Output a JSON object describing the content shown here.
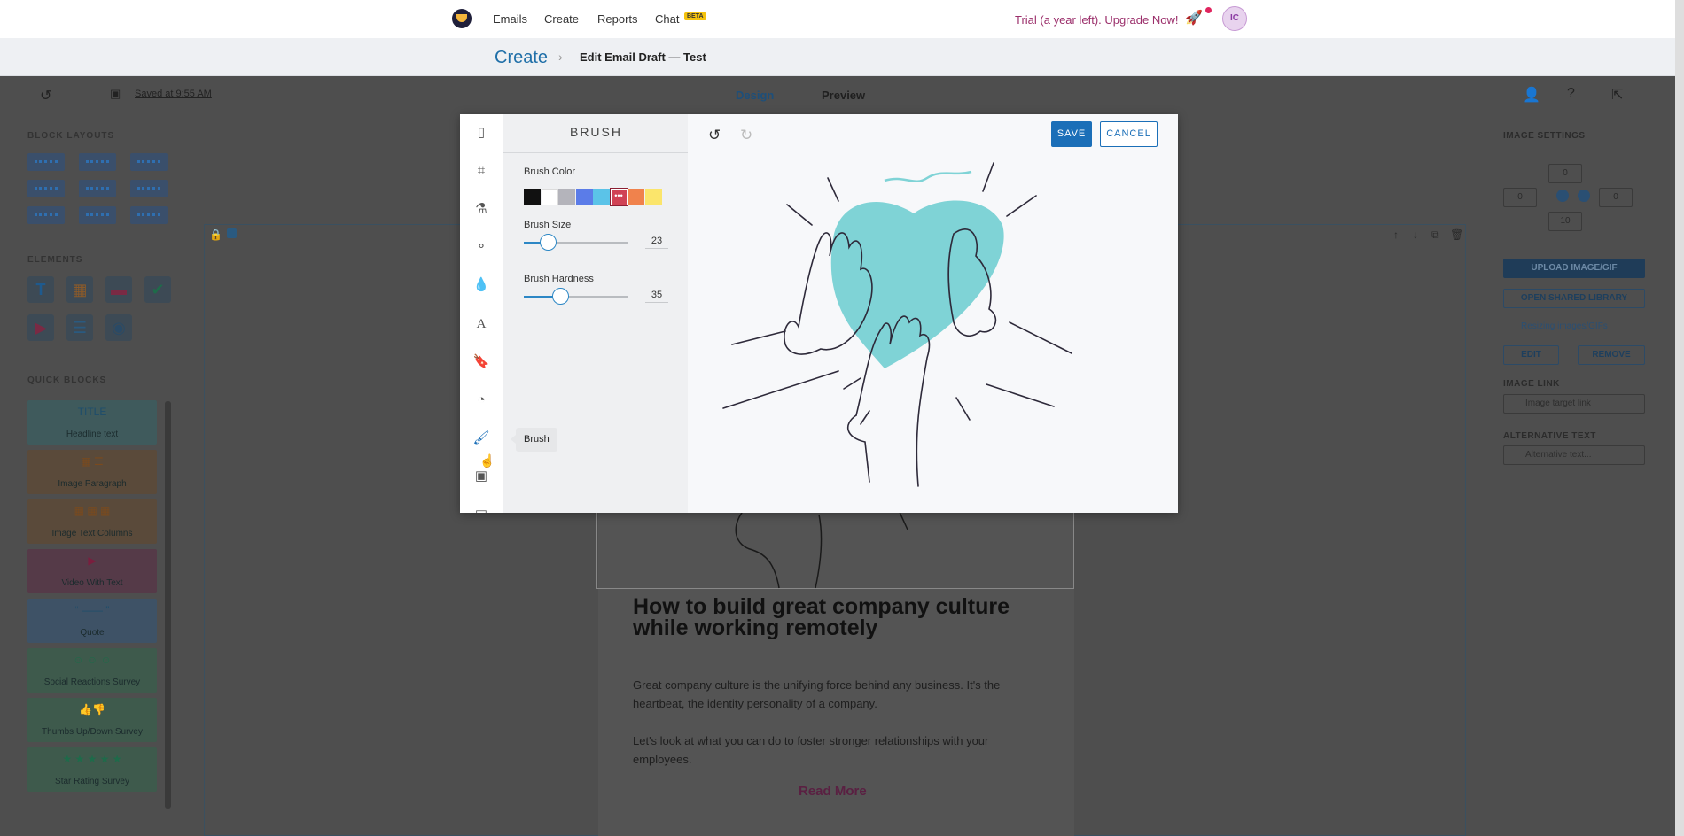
{
  "topnav": {
    "items": [
      "Emails",
      "Create",
      "Reports",
      "Chat"
    ],
    "chat_badge": "BETA",
    "trial_text": "Trial (a year left). Upgrade Now!",
    "avatar_initials": "IC"
  },
  "breadcrumb": {
    "root": "Create",
    "separator": "›",
    "title": "Edit Email Draft — Test"
  },
  "toolbar": {
    "saved_text": "Saved at 9:55 AM",
    "tabs": [
      "Design",
      "Preview"
    ],
    "active_tab": "Design"
  },
  "left_panel": {
    "block_layouts_title": "BLOCK LAYOUTS",
    "elements_title": "ELEMENTS",
    "element_icons": [
      "text-icon",
      "image-icon",
      "button-icon",
      "check-icon",
      "video-icon",
      "divider-icon",
      "social-icon"
    ],
    "quick_blocks_title": "QUICK BLOCKS",
    "quick_blocks": [
      {
        "icon_text": "TITLE",
        "label": "Headline text"
      },
      {
        "icon_text": "▦ ☰",
        "label": "Image Paragraph"
      },
      {
        "icon_text": "▦ ▦ ▦",
        "label": "Image Text Columns"
      },
      {
        "icon_text": "▶",
        "label": "Video With Text"
      },
      {
        "icon_text": "“ —— ”",
        "label": "Quote"
      },
      {
        "icon_text": "☺ ☺ ☺",
        "label": "Social Reactions Survey"
      },
      {
        "icon_text": "👍👎",
        "label": "Thumbs Up/Down Survey"
      },
      {
        "icon_text": "★ ★ ★ ★ ★",
        "label": "Star Rating Survey"
      }
    ]
  },
  "email": {
    "heading": "How to build great company culture while working remotely",
    "para1": "Great company culture is the unifying force behind any business. It's the heartbeat, the identity personality of a company.",
    "para2": "Let's look at what you can do to foster stronger relationships with your employees.",
    "read_more": "Read More"
  },
  "right_panel": {
    "image_settings_title": "IMAGE SETTINGS",
    "padding": {
      "top": "0",
      "left": "0",
      "right": "0",
      "bottom": "10"
    },
    "upload_button": "UPLOAD IMAGE/GIF",
    "shared_library_button": "OPEN SHARED LIBRARY",
    "resize_link": "Resizing images/GIFs",
    "edit_button": "EDIT",
    "remove_button": "REMOVE",
    "image_link_title": "IMAGE LINK",
    "image_link_placeholder": "Image target link",
    "alt_text_title": "ALTERNATIVE TEXT",
    "alt_text_placeholder": "Alternative text..."
  },
  "modal": {
    "panel_title": "BRUSH",
    "brush_color_label": "Brush Color",
    "colors": [
      "#111111",
      "#ffffff",
      "#b4b4bb",
      "#5b7ce8",
      "#5bc3e8",
      "#d04255",
      "#f0824c",
      "#fbe56b"
    ],
    "selected_color_index": 5,
    "brush_size_label": "Brush Size",
    "brush_size_value": "23",
    "brush_size_fraction": 0.23,
    "brush_hardness_label": "Brush Hardness",
    "brush_hardness_value": "35",
    "brush_hardness_fraction": 0.35,
    "save_label": "SAVE",
    "cancel_label": "CANCEL",
    "tooltip": "Brush",
    "heart_color": "#7fd3d6",
    "accent": "#1b6fb8"
  }
}
